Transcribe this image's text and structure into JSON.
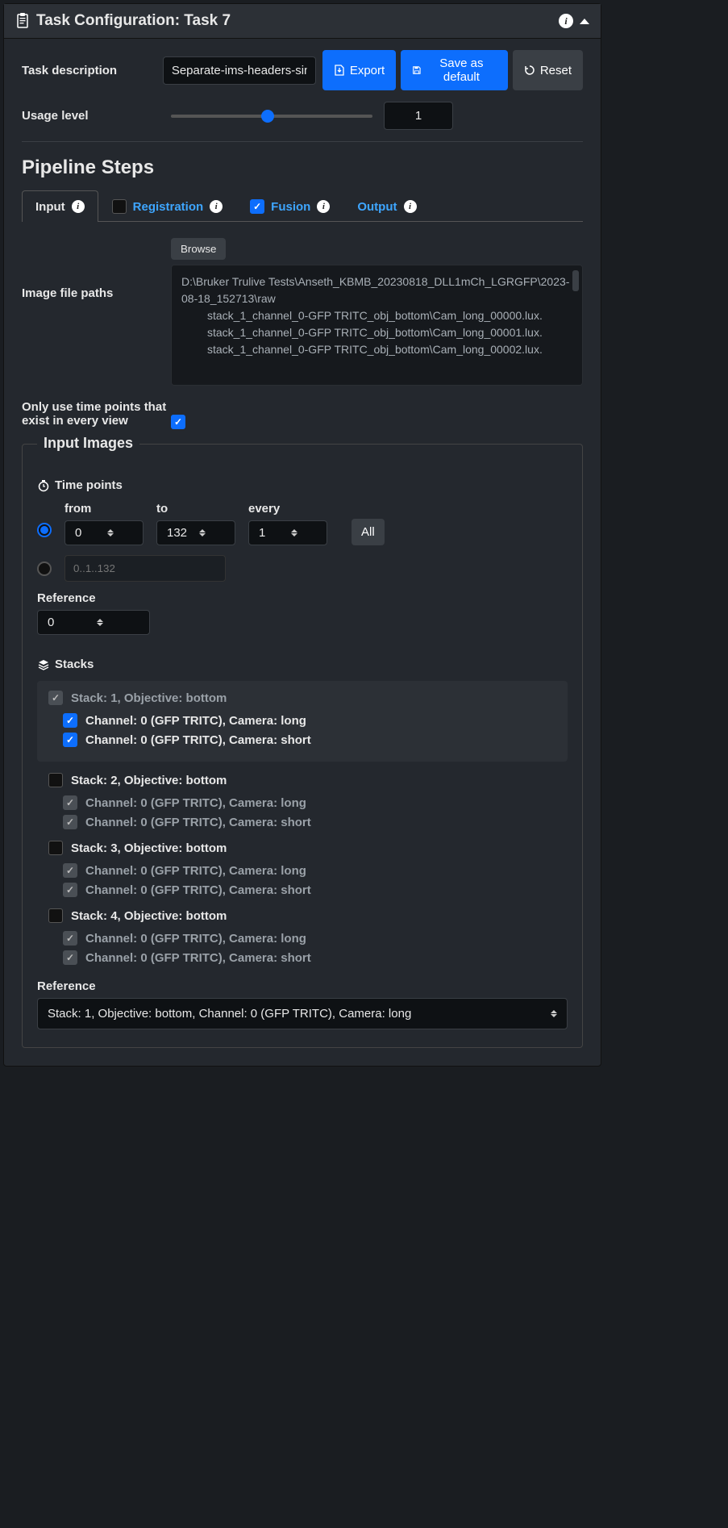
{
  "header": {
    "title": "Task Configuration: Task 7"
  },
  "task": {
    "description_label": "Task description",
    "description_value": "Separate-ims-headers-sin",
    "export_label": "Export",
    "save_default_label": "Save as default",
    "reset_label": "Reset",
    "usage_label": "Usage level",
    "usage_value": "1"
  },
  "pipeline": {
    "title": "Pipeline Steps",
    "tabs": [
      {
        "label": "Input",
        "active": true,
        "checkbox": false
      },
      {
        "label": "Registration",
        "active": false,
        "checkbox": true,
        "checked": false
      },
      {
        "label": "Fusion",
        "active": false,
        "checkbox": true,
        "checked": true
      },
      {
        "label": "Output",
        "active": false,
        "checkbox": false
      }
    ]
  },
  "input": {
    "paths_label": "Image file paths",
    "browse_label": "Browse",
    "base_path": "D:\\Bruker Trulive Tests\\Anseth_KBMB_20230818_DLL1mCh_LGRGFP\\2023-08-18_152713\\raw",
    "files": [
      "stack_1_channel_0-GFP TRITC_obj_bottom\\Cam_long_00000.lux.",
      "stack_1_channel_0-GFP TRITC_obj_bottom\\Cam_long_00001.lux.",
      "stack_1_channel_0-GFP TRITC_obj_bottom\\Cam_long_00002.lux."
    ],
    "only_label": "Only use time points that exist in every view",
    "only_checked": true
  },
  "images": {
    "legend": "Input Images",
    "timepoints": {
      "label": "Time points",
      "from_label": "from",
      "from_value": "0",
      "to_label": "to",
      "to_value": "132",
      "every_label": "every",
      "every_value": "1",
      "all_label": "All",
      "range_placeholder": "0..1..132"
    },
    "reference": {
      "label": "Reference",
      "value": "0"
    },
    "stacks_label": "Stacks",
    "stacks": [
      {
        "title": "Stack: 1, Objective: bottom",
        "selected": true,
        "header_disabled": true,
        "channels": [
          {
            "label": "Channel: 0 (GFP TRITC), Camera: long",
            "checked": true,
            "disabled": false
          },
          {
            "label": "Channel: 0 (GFP TRITC), Camera: short",
            "checked": true,
            "disabled": false
          }
        ]
      },
      {
        "title": "Stack: 2, Objective: bottom",
        "selected": false,
        "channels": [
          {
            "label": "Channel: 0 (GFP TRITC), Camera: long",
            "checked": true,
            "disabled": true
          },
          {
            "label": "Channel: 0 (GFP TRITC), Camera: short",
            "checked": true,
            "disabled": true
          }
        ]
      },
      {
        "title": "Stack: 3, Objective: bottom",
        "selected": false,
        "channels": [
          {
            "label": "Channel: 0 (GFP TRITC), Camera: long",
            "checked": true,
            "disabled": true
          },
          {
            "label": "Channel: 0 (GFP TRITC), Camera: short",
            "checked": true,
            "disabled": true
          }
        ]
      },
      {
        "title": "Stack: 4, Objective: bottom",
        "selected": false,
        "channels": [
          {
            "label": "Channel: 0 (GFP TRITC), Camera: long",
            "checked": true,
            "disabled": true
          },
          {
            "label": "Channel: 0 (GFP TRITC), Camera: short",
            "checked": true,
            "disabled": true
          }
        ]
      }
    ],
    "stack_reference": {
      "label": "Reference",
      "value": "Stack: 1, Objective: bottom, Channel: 0 (GFP TRITC), Camera: long"
    }
  }
}
